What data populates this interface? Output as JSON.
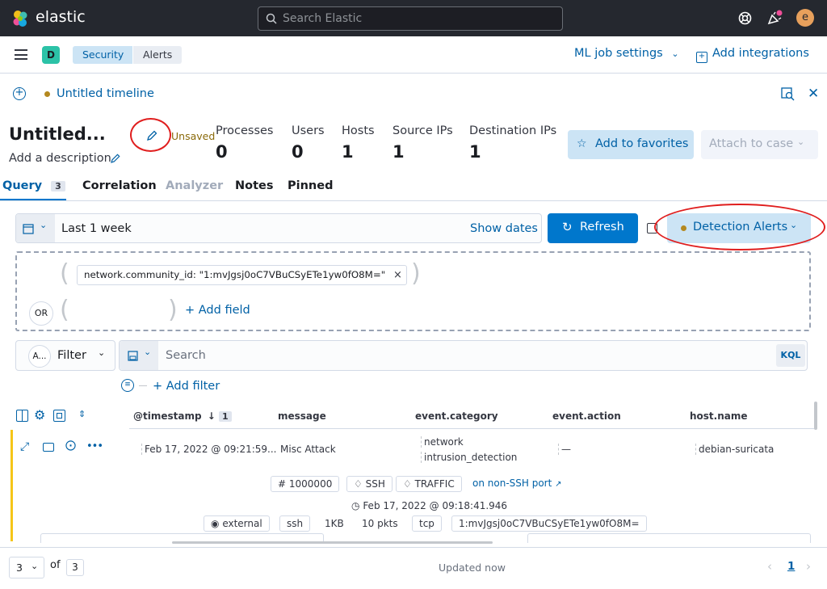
{
  "topbar": {
    "brand": "elastic",
    "search_placeholder": "Search Elastic",
    "avatar_letter": "e"
  },
  "subnav": {
    "space_letter": "D",
    "breadcrumbs": [
      "Security",
      "Alerts"
    ],
    "ml_job_settings": "ML job settings",
    "add_integrations": "Add integrations"
  },
  "timeline": {
    "tab_title": "Untitled timeline",
    "title": "Untitled...",
    "description_placeholder": "Add a description",
    "save_status": "Unsaved",
    "stats": [
      {
        "label": "Processes",
        "value": "0"
      },
      {
        "label": "Users",
        "value": "0"
      },
      {
        "label": "Hosts",
        "value": "1"
      },
      {
        "label": "Source IPs",
        "value": "1"
      },
      {
        "label": "Destination IPs",
        "value": "1"
      }
    ],
    "add_to_favorites": "Add to favorites",
    "attach_to_case": "Attach to case"
  },
  "tabs": {
    "query": "Query",
    "query_count": "3",
    "correlation": "Correlation",
    "analyzer": "Analyzer",
    "notes": "Notes",
    "pinned": "Pinned"
  },
  "querybar": {
    "date_range": "Last 1 week",
    "show_dates": "Show dates",
    "refresh": "Refresh",
    "data_view": "Detection Alerts"
  },
  "provider": {
    "field_pill": "network.community_id: \"1:mvJgsj0oC7VBuCSyETe1yw0fO8M=\"",
    "or_label": "OR",
    "add_field": "+ Add field"
  },
  "filterbar": {
    "kind_abbrev": "A...",
    "filter_label": "Filter",
    "search_placeholder": "Search",
    "kql": "KQL",
    "add_filter": "+ Add filter"
  },
  "table": {
    "columns": [
      "@timestamp",
      "message",
      "event.category",
      "event.action",
      "host.name"
    ],
    "sort_badge": "1",
    "row": {
      "timestamp": "Feb 17, 2022 @ 09:21:59...",
      "message": "Misc Attack",
      "category_1": "network",
      "category_2": "intrusion_detection",
      "action": "—",
      "host": "debian-suricata"
    },
    "detail": {
      "rule_id": "1000000",
      "tag_1": "SSH",
      "tag_2": "TRAFFIC",
      "link": "on non-SSH port",
      "time": "Feb 17, 2022 @ 09:18:41.946",
      "direction": "external",
      "protocol": "ssh",
      "bytes": "1KB",
      "packets": "10 pkts",
      "transport": "tcp",
      "community_id": "1:mvJgsj0oC7VBuCSyETe1yw0fO8M="
    }
  },
  "footer": {
    "page_size": "3",
    "of_label": "of",
    "total": "3",
    "updated": "Updated now",
    "current_page": "1"
  },
  "colors": {
    "accent": "#0077cc",
    "annotation": "#e01e1e",
    "unsaved": "#b4881f",
    "alert_row": "#f5c518"
  }
}
